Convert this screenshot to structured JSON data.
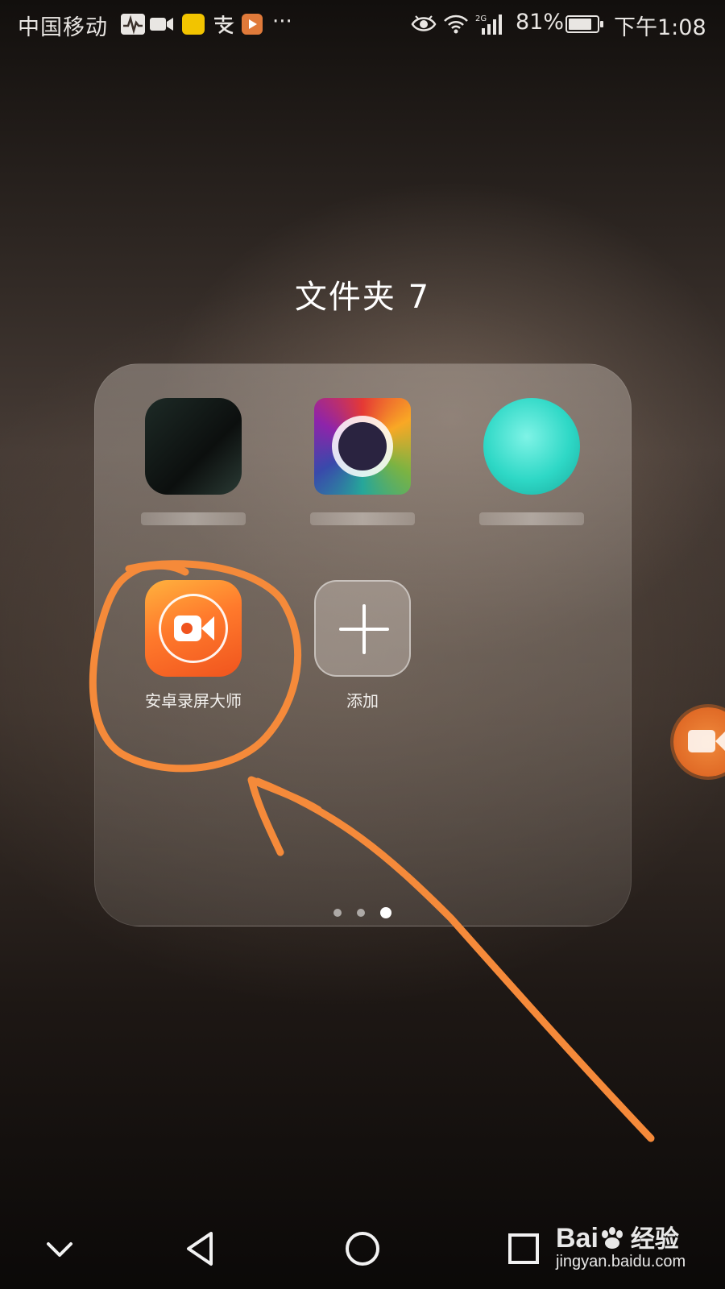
{
  "status_bar": {
    "carrier": "中国移动",
    "more_indicator": "···",
    "network_type": "2G",
    "battery_percent_text": "81%",
    "battery_level": 0.81,
    "time": "下午1:08",
    "icons": [
      "activity-icon",
      "video-icon",
      "app-notification-icon",
      "alipay-icon",
      "app-notification-icon",
      "more-icon",
      "eye-icon",
      "wifi-icon",
      "signal-icon",
      "battery-icon"
    ]
  },
  "folder": {
    "title": "文件夹 7",
    "apps": [
      {
        "label": "",
        "pixelated": true,
        "icon": "blurred-app-icon"
      },
      {
        "label": "",
        "pixelated": true,
        "icon": "blurred-app-icon"
      },
      {
        "label": "",
        "pixelated": true,
        "icon": "blurred-app-icon"
      },
      {
        "label": "安卓录屏大师",
        "pixelated": false,
        "icon": "screen-recorder-icon"
      },
      {
        "label": "添加",
        "pixelated": false,
        "icon": "plus-icon"
      }
    ],
    "page_count": 3,
    "current_page": 3
  },
  "floating_button": {
    "icon": "camera-icon",
    "color": "#e06a26"
  },
  "annotation": {
    "color": "#f58a3a",
    "shapes": [
      "circle-around-app",
      "arrow"
    ]
  },
  "nav_bar": {
    "buttons": [
      "chevron-down-icon",
      "back-icon",
      "home-icon",
      "recents-icon"
    ]
  },
  "watermark": {
    "brand": "Bai",
    "brand_cn": "经验",
    "url": "jingyan.baidu.com"
  }
}
